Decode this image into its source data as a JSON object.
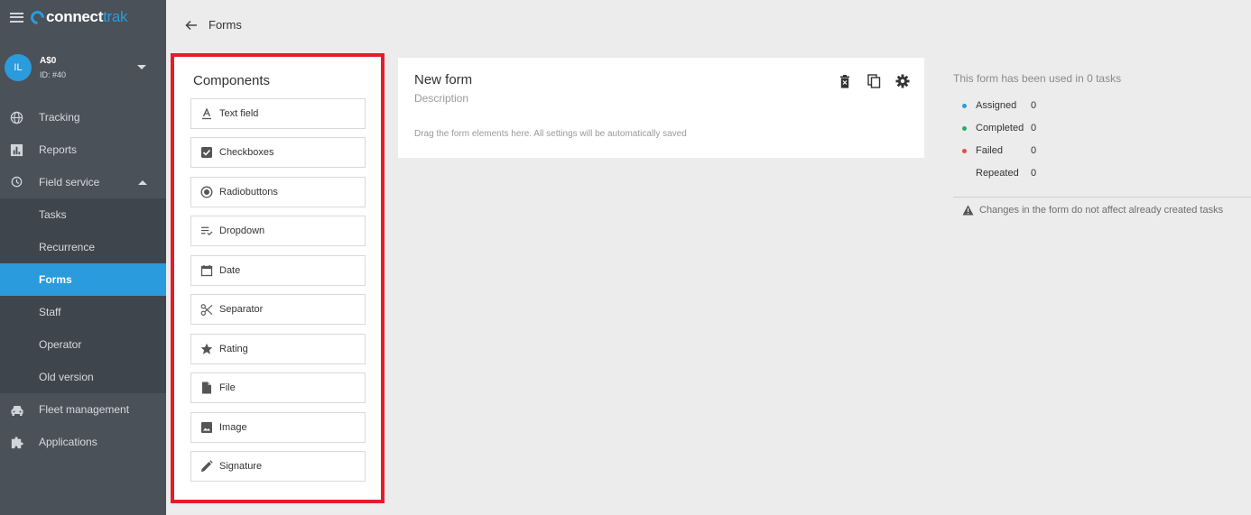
{
  "app": {
    "logo_part1": "connect",
    "logo_part2": "trak",
    "brand_color": "#2a9bdc"
  },
  "account": {
    "initials": "IL",
    "name": "A$0",
    "id": "ID: #40"
  },
  "nav": {
    "tracking": "Tracking",
    "reports": "Reports",
    "field_service": "Field service",
    "tasks": "Tasks",
    "recurrence": "Recurrence",
    "forms": "Forms",
    "staff": "Staff",
    "operator": "Operator",
    "old_version": "Old version",
    "fleet": "Fleet management",
    "applications": "Applications"
  },
  "header": {
    "title": "Forms"
  },
  "components": {
    "title": "Components",
    "items": [
      {
        "label": "Text field",
        "icon": "text-field-icon"
      },
      {
        "label": "Checkboxes",
        "icon": "checkbox-icon"
      },
      {
        "label": "Radiobuttons",
        "icon": "radio-icon"
      },
      {
        "label": "Dropdown",
        "icon": "dropdown-icon"
      },
      {
        "label": "Date",
        "icon": "calendar-icon"
      },
      {
        "label": "Separator",
        "icon": "scissors-icon"
      },
      {
        "label": "Rating",
        "icon": "star-icon"
      },
      {
        "label": "File",
        "icon": "file-icon"
      },
      {
        "label": "Image",
        "icon": "image-icon"
      },
      {
        "label": "Signature",
        "icon": "pencil-icon"
      }
    ]
  },
  "form": {
    "title": "New form",
    "description": "Description",
    "hint": "Drag the form elements here. All settings will be automatically saved"
  },
  "stats": {
    "title": "This form has been used in 0 tasks",
    "rows": [
      {
        "label": "Assigned",
        "value": "0",
        "color": "#2a9bdc"
      },
      {
        "label": "Completed",
        "value": "0",
        "color": "#27ae60"
      },
      {
        "label": "Failed",
        "value": "0",
        "color": "#e74c3c"
      },
      {
        "label": "Repeated",
        "value": "0",
        "color": ""
      }
    ],
    "warning": "Changes in the form do not affect already created tasks"
  }
}
